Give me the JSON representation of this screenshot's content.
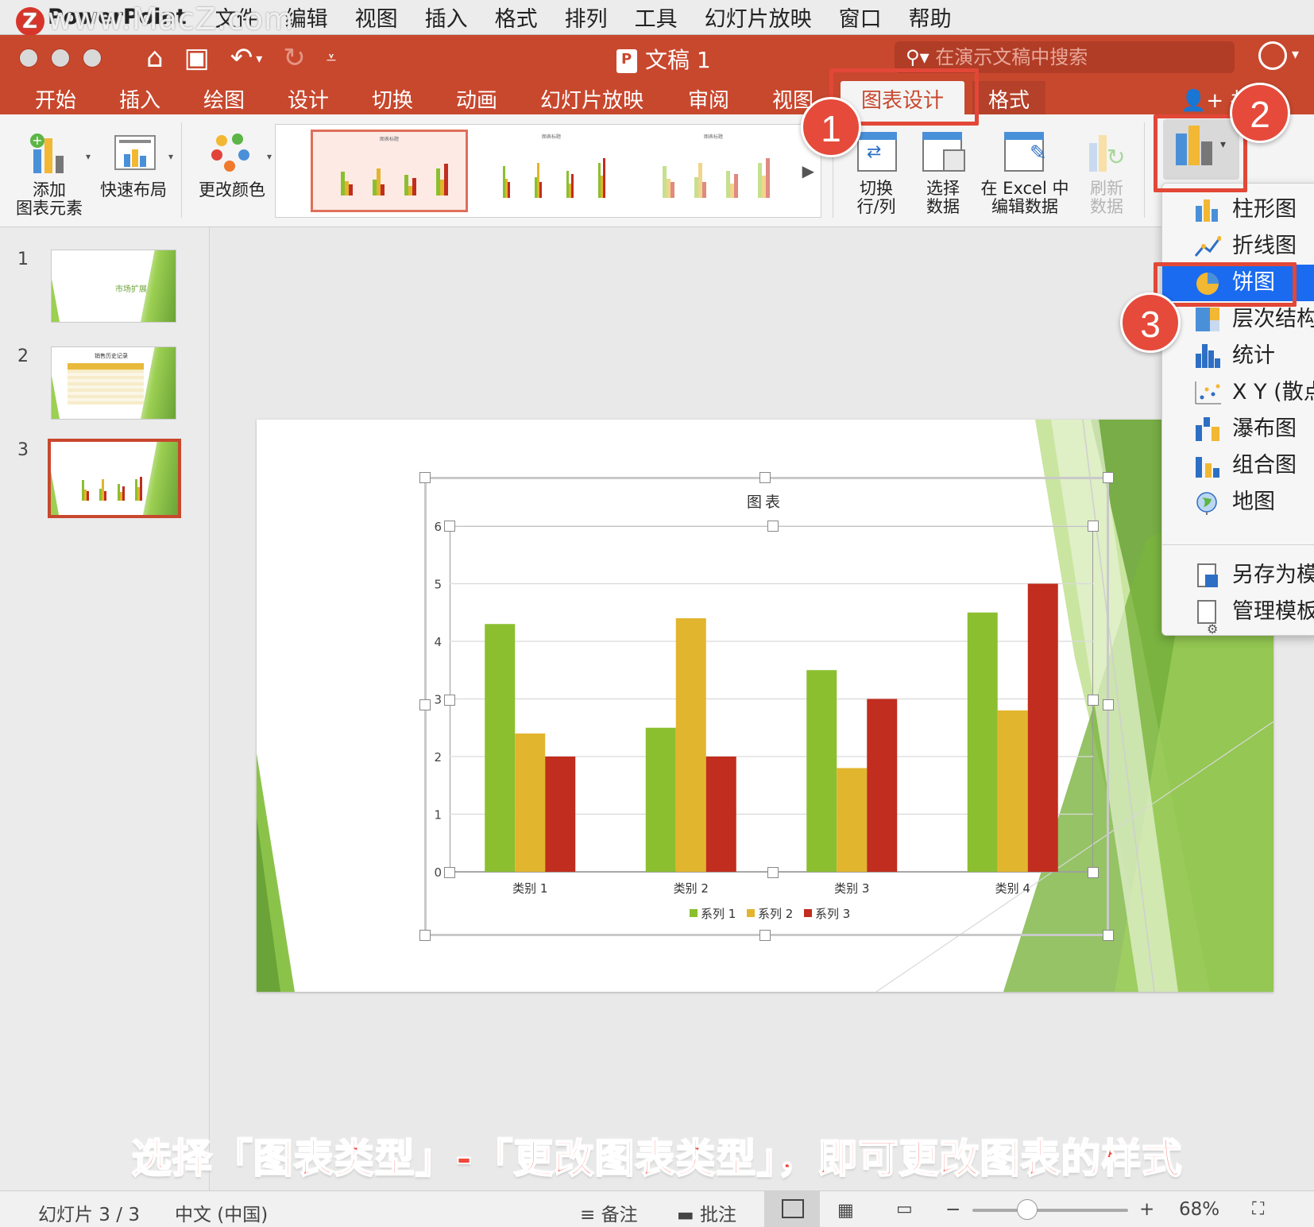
{
  "menubar": {
    "app_name": "PowerPoint",
    "items": [
      "文件",
      "编辑",
      "视图",
      "插入",
      "格式",
      "排列",
      "工具",
      "幻灯片放映",
      "窗口",
      "帮助"
    ],
    "watermark": "www.MacZ.com",
    "watermark_badge": "Z"
  },
  "titlebar": {
    "doc_title": "文稿 1",
    "search_placeholder": "在演示文稿中搜索"
  },
  "tabs": {
    "items": [
      "开始",
      "插入",
      "绘图",
      "设计",
      "切换",
      "动画",
      "幻灯片放映",
      "审阅",
      "视图"
    ],
    "active": "图表设计",
    "format": "格式",
    "share": "共享"
  },
  "ribbon": {
    "add_element": "添加\n图表元素",
    "add_element_l1": "添加",
    "add_element_l2": "图表元素",
    "quick_layout": "快速布局",
    "change_colors": "更改颜色",
    "switch_l1": "切换",
    "switch_l2": "行/列",
    "select_l1": "选择",
    "select_l2": "数据",
    "edit_excel_l1": "在 Excel 中",
    "edit_excel_l2": "编辑数据",
    "refresh_l1": "刷新",
    "refresh_l2": "数据",
    "gallery_thumb_title": "图表标题"
  },
  "steps": [
    "1",
    "2",
    "3"
  ],
  "slides": {
    "numbers": [
      "1",
      "2",
      "3"
    ],
    "slide1_title": "市场扩展",
    "slide2_title": "销售历史记录"
  },
  "chart_data": {
    "type": "bar",
    "title": "图表",
    "categories": [
      "类别 1",
      "类别 2",
      "类别 3",
      "类别 4"
    ],
    "series": [
      {
        "name": "系列 1",
        "values": [
          4.3,
          2.5,
          3.5,
          4.5
        ],
        "color": "#8bbf2f"
      },
      {
        "name": "系列 2",
        "values": [
          2.4,
          4.4,
          1.8,
          2.8
        ],
        "color": "#e2b52e"
      },
      {
        "name": "系列 3",
        "values": [
          2.0,
          2.0,
          3.0,
          5.0
        ],
        "color": "#c12d1e"
      }
    ],
    "yticks": [
      "0",
      "1",
      "2",
      "3",
      "4",
      "5",
      "6"
    ],
    "ylim": [
      0,
      6
    ],
    "grid": true,
    "legend": "bottom"
  },
  "dropdown": {
    "items": [
      "柱形图",
      "折线图",
      "饼图",
      "层次结构",
      "统计",
      "X Y (散点",
      "瀑布图",
      "组合图",
      "地图"
    ],
    "selected": "饼图",
    "extra": [
      "另存为模",
      "管理模板"
    ]
  },
  "caption": "选择「图表类型」-「更改图表类型」，即可更改图表的样式",
  "statusbar": {
    "slide_info": "幻灯片 3 / 3",
    "language": "中文 (中国)",
    "notes": "备注",
    "comments": "批注",
    "zoom": "68%",
    "zoom_level": 0.35
  },
  "colors": {
    "accent": "#c8482e",
    "highlight": "#e24737",
    "selection_blue": "#1a6bf0",
    "green": "#8bbf2f",
    "gold": "#e2b52e",
    "red": "#c12d1e"
  }
}
